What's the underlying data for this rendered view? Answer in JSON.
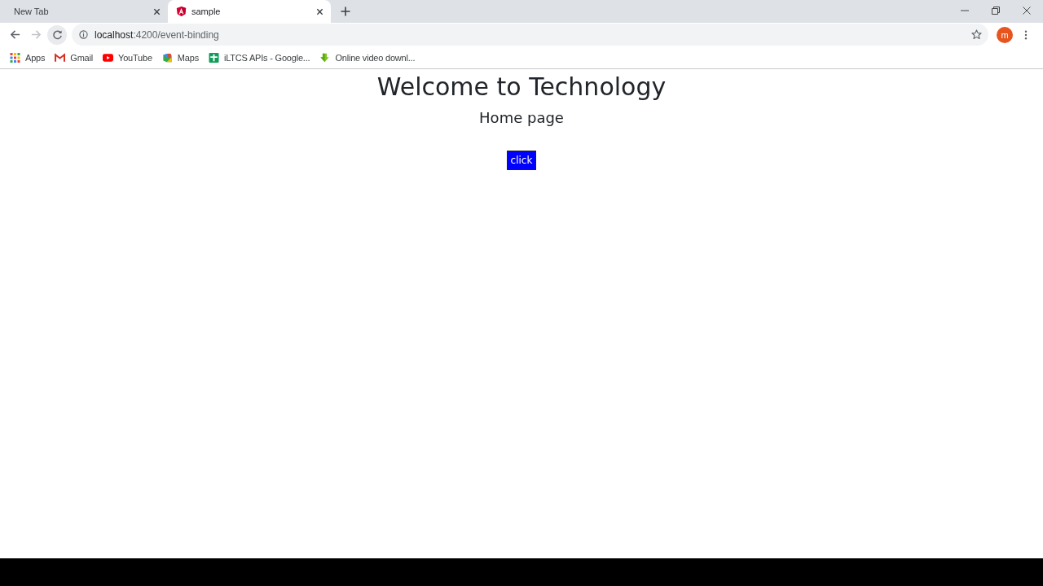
{
  "browser": {
    "tabs": [
      {
        "title": "New Tab",
        "kind": "blank",
        "selected": false
      },
      {
        "title": "sample",
        "kind": "site",
        "selected": true
      }
    ],
    "toolbar": {
      "address_host": "localhost",
      "address_path": ":4200/event-binding",
      "profile_initial": "m"
    },
    "bookmarks": [
      {
        "label": "Apps",
        "kind": "apps"
      },
      {
        "label": "Gmail",
        "kind": "gmail"
      },
      {
        "label": "YouTube",
        "kind": "youtube"
      },
      {
        "label": "Maps",
        "kind": "maps"
      },
      {
        "label": "iLTCS APIs - Google...",
        "kind": "sheets"
      },
      {
        "label": "Online video downl...",
        "kind": "download"
      }
    ]
  },
  "page": {
    "heading": "Welcome to Technology",
    "subheading": "Home page",
    "button": "click"
  }
}
